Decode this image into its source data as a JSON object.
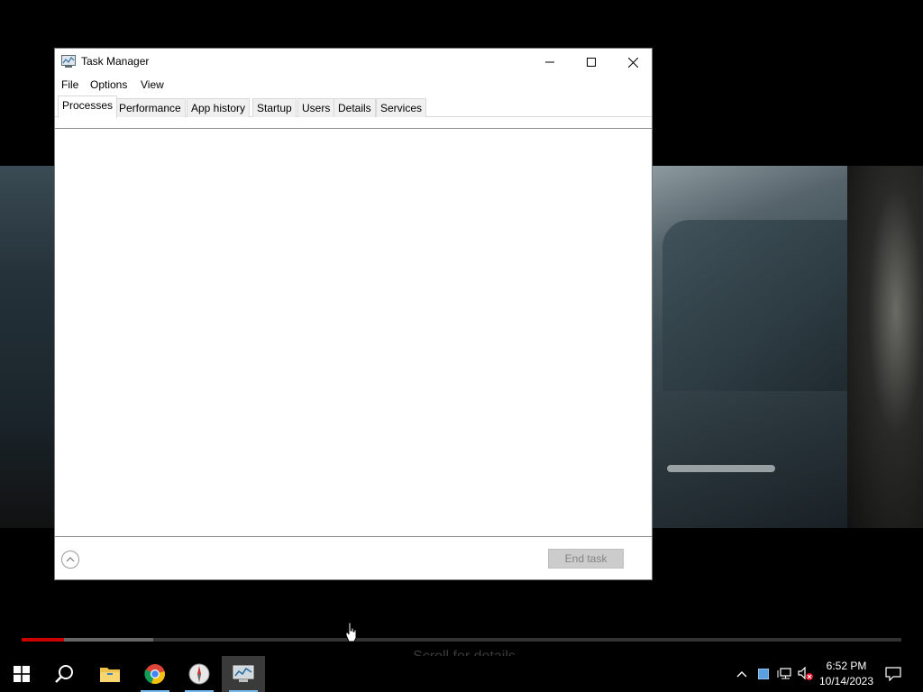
{
  "window": {
    "title": "Task Manager",
    "controls": {
      "minimize": "minimize",
      "maximize": "maximize",
      "close": "close"
    }
  },
  "menu": [
    "File",
    "Options",
    "View"
  ],
  "tabs": [
    "Processes",
    "Performance",
    "App history",
    "Startup",
    "Users",
    "Details",
    "Services"
  ],
  "active_tab": "Processes",
  "footer": {
    "end_task_label": "End task",
    "end_task_enabled": false
  },
  "video": {
    "scroll_hint": "Scroll for details",
    "played_fraction": 0.048,
    "buffered_fraction": 0.15
  },
  "taskbar": {
    "apps": [
      {
        "name": "start",
        "icon": "windows-start-icon"
      },
      {
        "name": "search",
        "icon": "search-icon"
      },
      {
        "name": "file-explorer",
        "icon": "folder-icon"
      },
      {
        "name": "chrome",
        "icon": "chrome-icon"
      },
      {
        "name": "compass-app",
        "icon": "compass-icon"
      },
      {
        "name": "task-manager",
        "icon": "task-manager-icon",
        "active": true
      }
    ],
    "clock": {
      "time": "6:52 PM",
      "date": "10/14/2023"
    }
  },
  "colors": {
    "accent": "#76b9ed",
    "progress_played": "#cc0000"
  }
}
